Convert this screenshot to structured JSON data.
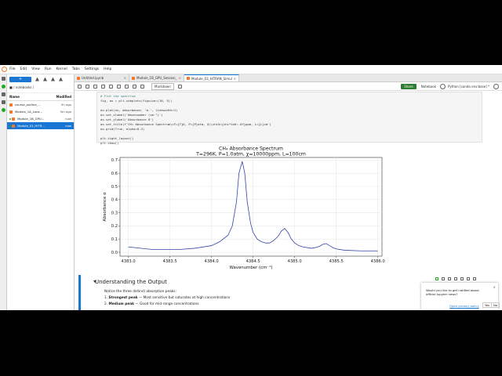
{
  "menu": [
    "File",
    "Edit",
    "View",
    "Run",
    "Kernel",
    "Tabs",
    "Settings",
    "Help"
  ],
  "file_browser": {
    "new_label": "+",
    "path": "■ / notebooks /",
    "col_name": "Name",
    "col_modified": "Modified",
    "files": [
      {
        "name": "course_outline_...",
        "modified": "5h ago",
        "selected": false
      },
      {
        "name": "Module_1A_Loca...",
        "modified": "5m ago",
        "selected": false
      },
      {
        "name": "Module_1B_GPU...",
        "modified": "now",
        "selected": false
      },
      {
        "name": "Module_03_HITR...",
        "modified": "now",
        "selected": true
      }
    ]
  },
  "tabs": [
    {
      "label": "Untitled.ipynb",
      "active": false
    },
    {
      "label": "Module_1B_GPU_Session_",
      "active": false
    },
    {
      "label": "Module_03_HITRAN_Simul",
      "active": true
    }
  ],
  "toolbar": {
    "cell_type": "Markdown",
    "share_label": "Share",
    "notebook_label": "Notebook",
    "kernel_label": "Python [conda env:base] *"
  },
  "code_lines": [
    {
      "text": "# Plot the spectrum",
      "comment": true
    },
    {
      "text": "fig, ax = plt.subplots(figsize=(10, 5))",
      "comment": false
    },
    {
      "text": "",
      "comment": false
    },
    {
      "text": "ax.plot(nu, absorbance, 'b-', linewidth=1)",
      "comment": false
    },
    {
      "text": "ax.set_xlabel('Wavenumber (cm⁻¹)')",
      "comment": false
    },
    {
      "text": "ax.set_ylabel('Absorbance α')",
      "comment": false
    },
    {
      "text": "ax.set_title(f'CH₄ Absorbance Spectrum\\nT={T}K, P={P}atm, $\\\\chi$={chi*1e6:.0f}ppm, L={L}cm')",
      "comment": false
    },
    {
      "text": "ax.grid(True, alpha=0.3)",
      "comment": false
    },
    {
      "text": "",
      "comment": false
    },
    {
      "text": "plt.tight_layout()",
      "comment": false
    },
    {
      "text": "plt.show()",
      "comment": false
    }
  ],
  "chart_data": {
    "type": "line",
    "title": "CH₄ Absorbance Spectrum",
    "subtitle": "T=296K, P=1.0atm, χ=10000ppm, L=100cm",
    "xlabel": "Wavenumber (cm⁻¹)",
    "ylabel": "Absorbance α",
    "xlim": [
      4382.9,
      4386.05
    ],
    "ylim": [
      -0.03,
      0.72
    ],
    "xticks": [
      4383.0,
      4383.5,
      4384.0,
      4384.5,
      4385.0,
      4385.5,
      4386.0
    ],
    "xtick_labels": [
      "4383.0",
      "4383.5",
      "4384.0",
      "4384.5",
      "4385.0",
      "4385.5",
      "4386.0"
    ],
    "yticks": [
      0.0,
      0.1,
      0.2,
      0.3,
      0.4,
      0.5,
      0.6,
      0.7
    ],
    "ytick_labels": [
      "0.0",
      "0.1",
      "0.2",
      "0.3",
      "0.4",
      "0.5",
      "0.6",
      "0.7"
    ],
    "grid": true,
    "color": "#3344aa",
    "series": [
      {
        "x": [
          4383.0,
          4383.3,
          4383.6,
          4383.8,
          4384.0,
          4384.1,
          4384.2,
          4384.25,
          4384.3,
          4384.33,
          4384.37,
          4384.4,
          4384.43,
          4384.47,
          4384.5,
          4384.55,
          4384.6,
          4384.65,
          4384.7,
          4384.75,
          4384.8,
          4384.84,
          4384.88,
          4384.92,
          4384.96,
          4385.0,
          4385.05,
          4385.1,
          4385.2,
          4385.25,
          4385.3,
          4385.34,
          4385.38,
          4385.42,
          4385.46,
          4385.5,
          4385.6,
          4385.8,
          4386.0
        ],
        "y": [
          0.04,
          0.02,
          0.02,
          0.03,
          0.05,
          0.08,
          0.13,
          0.2,
          0.38,
          0.6,
          0.69,
          0.6,
          0.38,
          0.22,
          0.15,
          0.1,
          0.08,
          0.07,
          0.07,
          0.09,
          0.12,
          0.16,
          0.18,
          0.15,
          0.1,
          0.07,
          0.05,
          0.04,
          0.03,
          0.035,
          0.045,
          0.06,
          0.065,
          0.05,
          0.035,
          0.025,
          0.015,
          0.01,
          0.01
        ]
      }
    ]
  },
  "markdown": {
    "heading": "Understanding the Output",
    "para": "Notice the three distinct absorption peaks:",
    "item1_num": "1.",
    "item1_bold": "Strongest peak",
    "item1_rest": " — Most sensitive but saturates at high concentrations",
    "item2_num": "2.",
    "item2_bold": "Medium peak",
    "item2_rest": " — Good for mid-range concentrations"
  },
  "notification": {
    "text": "Would you like to get notified about official Jupyter news?",
    "link": "Open privacy policy",
    "yes": "Yes",
    "no": "No",
    "close": "×"
  }
}
